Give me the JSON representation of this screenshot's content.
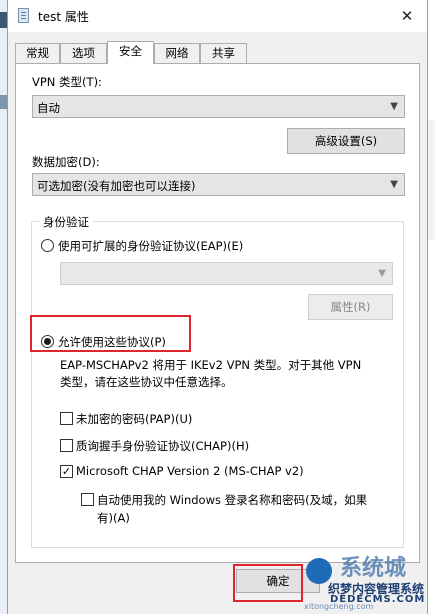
{
  "window": {
    "title": "test 属性",
    "close_glyph": "✕"
  },
  "tabs": [
    "常规",
    "选项",
    "安全",
    "网络",
    "共享"
  ],
  "active_tab": "安全",
  "vpn_type": {
    "label": "VPN 类型(T):",
    "value": "自动"
  },
  "advanced_button": "高级设置(S)",
  "encryption": {
    "label": "数据加密(D):",
    "value": "可选加密(没有加密也可以连接)"
  },
  "auth": {
    "legend": "身份验证",
    "eap_radio": "使用可扩展的身份验证协议(EAP)(E)",
    "eap_value": "",
    "properties_button": "属性(R)",
    "allow_radio": "允许使用这些协议(P)",
    "note_line1": "EAP-MSCHAPv2 将用于 IKEv2 VPN 类型。对于其他 VPN",
    "note_line2": "类型，请在这些协议中任意选择。",
    "pap": {
      "label": "未加密的密码(PAP)(U)",
      "checked": false
    },
    "chap": {
      "label": "质询握手身份验证协议(CHAP)(H)",
      "checked": false
    },
    "mschap": {
      "label": "Microsoft CHAP Version 2 (MS-CHAP v2)",
      "checked": true,
      "mark": "✓"
    },
    "autologon": {
      "line1": "自动使用我的 Windows 登录名称和密码(及域，如果",
      "line2": "有)(A)",
      "checked": false
    }
  },
  "ok_button": "确定",
  "watermark": {
    "logo_text": "系统城",
    "site_cn": "织梦内容管理系统",
    "site_en": "DEDECMS.COM",
    "site_small": "xitongcheng.com"
  },
  "colors": {
    "highlight": "#e0262c",
    "panel_bg": "#ffffff",
    "dialog_bg": "#f0f0f0"
  }
}
